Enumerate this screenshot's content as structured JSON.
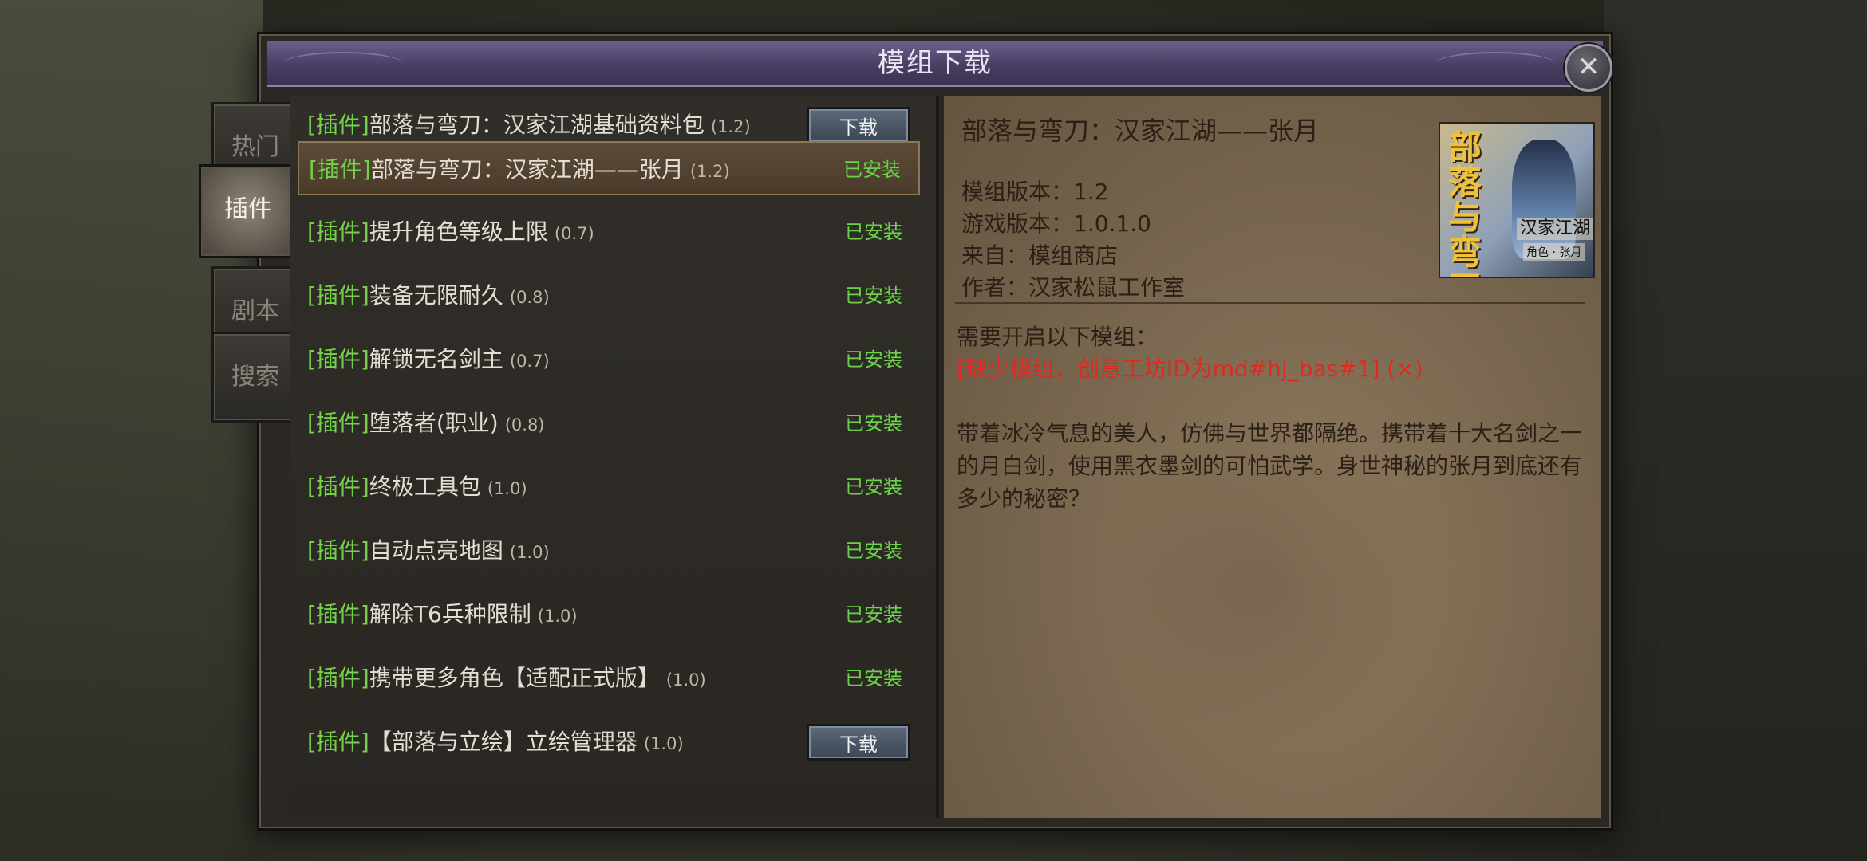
{
  "dialog": {
    "title": "模组下载",
    "close_icon": "close-icon"
  },
  "tabs": [
    {
      "label": "热门",
      "active": false
    },
    {
      "label": "插件",
      "active": true
    },
    {
      "label": "剧本",
      "active": false
    },
    {
      "label": "搜索",
      "active": false
    }
  ],
  "mods": [
    {
      "tag": "[插件]",
      "name": "部落与弯刀：汉家江湖基础资料包",
      "version": "(1.2)",
      "status": "download",
      "action_label": "下载"
    },
    {
      "tag": "[插件]",
      "name": "部落与弯刀：汉家江湖——张月",
      "version": "(1.2)",
      "status": "installed",
      "action_label": "已安装",
      "selected": true
    },
    {
      "tag": "[插件]",
      "name": "提升角色等级上限",
      "version": "(0.7)",
      "status": "installed",
      "action_label": "已安装"
    },
    {
      "tag": "[插件]",
      "name": "装备无限耐久",
      "version": "(0.8)",
      "status": "installed",
      "action_label": "已安装"
    },
    {
      "tag": "[插件]",
      "name": "解锁无名剑主",
      "version": "(0.7)",
      "status": "installed",
      "action_label": "已安装"
    },
    {
      "tag": "[插件]",
      "name": "堕落者(职业)",
      "version": "(0.8)",
      "status": "installed",
      "action_label": "已安装"
    },
    {
      "tag": "[插件]",
      "name": "终极工具包",
      "version": "(1.0)",
      "status": "installed",
      "action_label": "已安装"
    },
    {
      "tag": "[插件]",
      "name": "自动点亮地图",
      "version": "(1.0)",
      "status": "installed",
      "action_label": "已安装"
    },
    {
      "tag": "[插件]",
      "name": "解除T6兵种限制",
      "version": "(1.0)",
      "status": "installed",
      "action_label": "已安装"
    },
    {
      "tag": "[插件]",
      "name": "携带更多角色【适配正式版】",
      "version": "(1.0)",
      "status": "installed",
      "action_label": "已安装"
    },
    {
      "tag": "[插件]",
      "name": "【部落与立绘】立绘管理器",
      "version": "(1.0)",
      "status": "download",
      "action_label": "下载"
    }
  ],
  "detail": {
    "title": "部落与弯刀：汉家江湖——张月",
    "mod_version": "模组版本：1.2",
    "game_version": "游戏版本：1.0.1.0",
    "source": "来自：模组商店",
    "author": "作者：汉家松鼠工作室",
    "requirements_label": "需要开启以下模组：",
    "missing_requirement": "[缺少模组，创意工坊ID为md#hj_bas#1] (×)",
    "description": "带着冰冷气息的美人，仿佛与世界都隔绝。携带着十大名剑之一的月白剑，使用黑衣墨剑的可怕武学。身世神秘的张月到底还有多少的秘密？",
    "cover": {
      "calligraphy": "部落与弯刀",
      "subtitle": "汉家江湖",
      "subtitle2": "角色 · 张月"
    }
  },
  "colors": {
    "tag_green": "#74d24a",
    "installed_green": "#6ad34a",
    "missing_red": "#e02a1f",
    "title_purple": "#4a3e63"
  }
}
